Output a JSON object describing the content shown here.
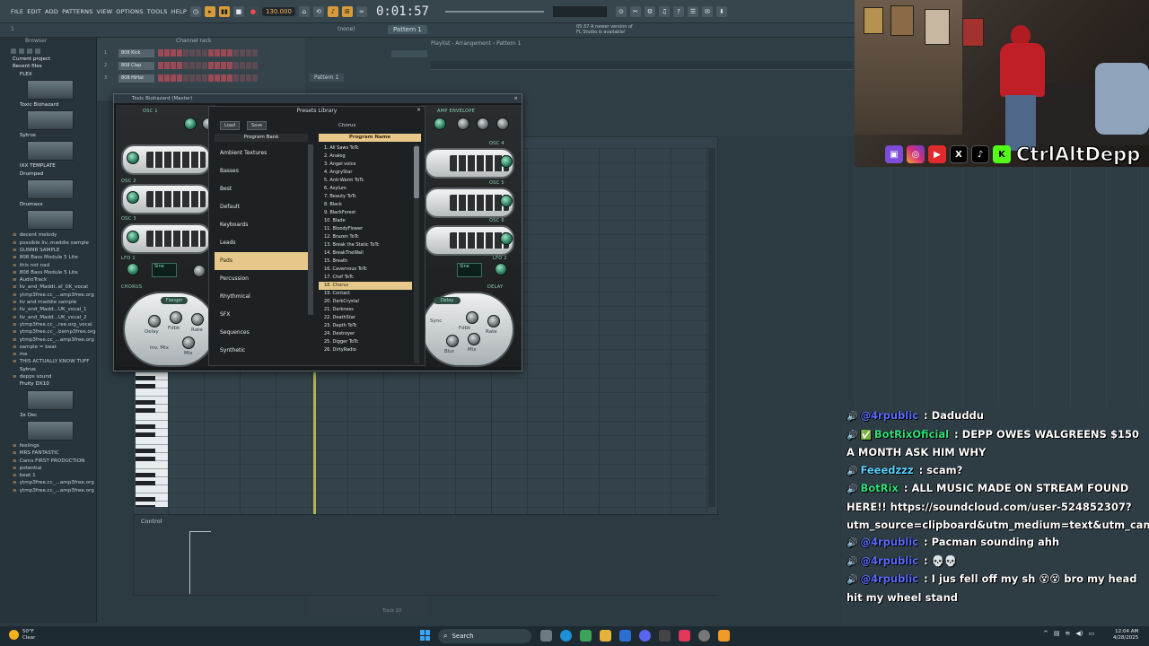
{
  "menu": [
    "FILE",
    "EDIT",
    "ADD",
    "PATTERNS",
    "VIEW",
    "OPTIONS",
    "TOOLS",
    "HELP"
  ],
  "transport": {
    "tempo": "130.000",
    "time": "0:01:57",
    "pattern": "Pattern 1",
    "mode": "(none)"
  },
  "notice": {
    "line1": "05:37  A newer version of",
    "line2": "FL Studio is available!"
  },
  "browser": {
    "header": "Browser",
    "items": [
      {
        "label": "Current project",
        "kind": "root"
      },
      {
        "label": "Recent files",
        "kind": "root"
      },
      {
        "label": "FLEX",
        "kind": "folder"
      },
      {
        "label": "",
        "kind": "thumb"
      },
      {
        "label": "Toxic Biohazard",
        "kind": "folder"
      },
      {
        "label": "",
        "kind": "thumb"
      },
      {
        "label": "Sytrus",
        "kind": "folder"
      },
      {
        "label": "",
        "kind": "thumb"
      },
      {
        "label": "IXX TEMPLATE",
        "kind": "folder"
      },
      {
        "label": "Drumpad",
        "kind": "folder"
      },
      {
        "label": "",
        "kind": "thumb"
      },
      {
        "label": "Drumaxx",
        "kind": "folder"
      },
      {
        "label": "",
        "kind": "thumb"
      },
      {
        "label": "decent melody",
        "kind": "file"
      },
      {
        "label": "possible liv..maddie sample",
        "kind": "file"
      },
      {
        "label": "GUNNR SAMPLE",
        "kind": "file"
      },
      {
        "label": "808 Bass Module 5 Lite",
        "kind": "file"
      },
      {
        "label": "this not nad",
        "kind": "file"
      },
      {
        "label": "808 Bass Module 5 Lite",
        "kind": "file"
      },
      {
        "label": "AudioTrack",
        "kind": "file"
      },
      {
        "label": "liv_and_Maddi..el_UK_vocal",
        "kind": "file"
      },
      {
        "label": "ytmp3free.cc_...amp3free.org",
        "kind": "file"
      },
      {
        "label": "liv and maddie sample",
        "kind": "file"
      },
      {
        "label": "liv_and_Madd...UK_vocal_1",
        "kind": "file"
      },
      {
        "label": "liv_and_Madd...UK_vocal_2",
        "kind": "file"
      },
      {
        "label": "ytmp3free.cc_..ree.org_vocal",
        "kind": "file"
      },
      {
        "label": "ytmp3free.cc_..bemp3free.org",
        "kind": "file"
      },
      {
        "label": "ytmp3free.cc_...amp3free.org",
        "kind": "file"
      },
      {
        "label": "sample = beat",
        "kind": "file"
      },
      {
        "label": "me",
        "kind": "file"
      },
      {
        "label": "THIS ACTUALLY KNOW TUFF",
        "kind": "file"
      },
      {
        "label": "Sytrus",
        "kind": "folder"
      },
      {
        "label": "depps sound",
        "kind": "file"
      },
      {
        "label": "Fruity DX10",
        "kind": "folder"
      },
      {
        "label": "",
        "kind": "thumb"
      },
      {
        "label": "3x Osc",
        "kind": "folder"
      },
      {
        "label": "",
        "kind": "thumb"
      },
      {
        "label": "feelings",
        "kind": "file"
      },
      {
        "label": "MRS FANTASTIC",
        "kind": "file"
      },
      {
        "label": "Cams FIRST PRODUCTION",
        "kind": "file"
      },
      {
        "label": "potential",
        "kind": "file"
      },
      {
        "label": "beat 1",
        "kind": "file"
      },
      {
        "label": "ytmp3free.cc_...amp3free.org",
        "kind": "file"
      },
      {
        "label": "ytmp3free.cc_...amp3free.org",
        "kind": "file"
      }
    ]
  },
  "channel_rack": {
    "title": "Channel rack",
    "channels": [
      {
        "num": "1",
        "name": "808 Kick"
      },
      {
        "num": "2",
        "name": "808 Clap"
      },
      {
        "num": "3",
        "name": "808 HiHat"
      }
    ]
  },
  "playlist": {
    "title": "Playlist - Arrangement › Pattern 1",
    "pattern_row": "Pattern 1"
  },
  "plugin": {
    "title": "Toxic Biohazard (Master)",
    "left_tags": [
      "OSC 1",
      "OSC 2",
      "OSC 3",
      "LFO 1",
      "CHORUS"
    ],
    "right_tags": [
      "AMP ENVELOPE",
      "OSC 4",
      "OSC 5",
      "OSC 6",
      "LFO 2",
      "DELAY"
    ],
    "lfo_label": "Sine",
    "fx_left": {
      "pill": "Flanger",
      "delay": "Delay",
      "fdbk": "Fdbk",
      "rate": "Rate",
      "inv": "Inv. Mix",
      "mix": "Mix"
    },
    "fx_right": {
      "pill": "Delay",
      "sync": "Sync",
      "fdbk": "Fdbk",
      "rate": "Rate",
      "blur": "Blur",
      "mix": "Mix"
    }
  },
  "presets": {
    "title": "Presets Library",
    "load": "Load",
    "save": "Save",
    "search_value": "Chorus",
    "bank_header": "Program Bank",
    "program_header": "Program Name",
    "banks": [
      "Ambient Textures",
      "Basses",
      "Best",
      "Default",
      "Keyboards",
      "Leads",
      "Pads",
      "Percussion",
      "Rhythmical",
      "SFX",
      "Sequences",
      "Synthetic"
    ],
    "selected_bank": 6,
    "programs": [
      "1. All Saws ToTc",
      "2. Analog",
      "3. Angel voice",
      "4. AngryStar",
      "5. Anti-Warm ToTc",
      "6. Asylum",
      "7. Beauty ToTc",
      "8. Black",
      "9. BlackForest",
      "10. Blade",
      "11. BloodyFlower",
      "12. Brazen ToTc",
      "13. Break the Static ToTc",
      "14. BreakTheWall",
      "15. Breath",
      "16. Cavernous ToTc",
      "17. Chef ToTc",
      "18. Chorus",
      "19. Contact",
      "20. DarkCrystal",
      "21. Darkness",
      "22. DeathStar",
      "23. Depth ToTc",
      "24. Destroyer",
      "25. Digger ToTc",
      "26. DirtyRadio"
    ],
    "selected_program": 17
  },
  "piano_roll": {
    "control_label": "Control",
    "strip_label": "Track 20"
  },
  "overlay": {
    "handle": "CtrlAltDepp",
    "socials": [
      "twitch-icon",
      "instagram-icon",
      "youtube-icon",
      "x-icon",
      "tiktok-icon",
      "kick-icon"
    ]
  },
  "chat": [
    {
      "badge": "",
      "user": "@4rpublic",
      "user_color": "#5b6cff",
      "text": "Daduddu"
    },
    {
      "badge": "✅",
      "user": "BotRixOficial",
      "user_color": "#2ee07a",
      "text": "DEPP OWES WALGREENS $150 A MONTH ASK HIM WHY"
    },
    {
      "badge": "",
      "user": "Feeedzzz",
      "user_color": "#5ad3ff",
      "text": "scam?"
    },
    {
      "badge": "",
      "user": "BotRix",
      "user_color": "#2ee07a",
      "text": "ALL MUSIC MADE ON STREAM FOUND HERE!! https://soundcloud.com/user-524852307?utm_source=clipboard&utm_medium=text&utm_campaign=social_sharing"
    },
    {
      "badge": "",
      "user": "@4rpublic",
      "user_color": "#5b6cff",
      "text": "Pacman sounding ahh"
    },
    {
      "badge": "",
      "user": "@4rpublic",
      "user_color": "#5b6cff",
      "text": "💀💀"
    },
    {
      "badge": "",
      "user": "@4rpublic",
      "user_color": "#5b6cff",
      "text": "I jus fell off my sh 😵😵 bro my head hit my wheel stand"
    }
  ],
  "taskbar": {
    "weather_temp": "50°F",
    "weather_desc": "Clear",
    "search": "Search",
    "time": "12:04 AM",
    "date": "4/28/2025"
  }
}
